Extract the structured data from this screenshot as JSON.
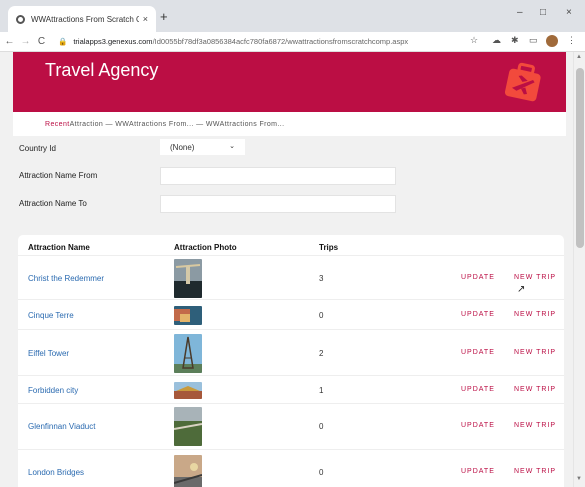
{
  "browser": {
    "tab_title": "WWAttractions From Scratch Co",
    "tab_close": "×",
    "new_tab": "+",
    "window_controls": {
      "minimize": "–",
      "maximize": "□",
      "close": "×"
    },
    "nav": {
      "back": "←",
      "forward": "→",
      "reload": "C"
    },
    "url_host": "trialapps3.genexus.com",
    "url_path": "/Id0055bf78df3a0856384acfc780fa6872/wwattractionsfromscratchcomp.aspx",
    "toolbar_icons": [
      "star-icon",
      "cloud-icon",
      "puzzle-icon",
      "cast-icon",
      "profile-avatar",
      "menu-icon"
    ]
  },
  "header": {
    "brand": "Travel Agency",
    "logo_icon": "suitcase-plane-icon",
    "accent_color": "#bb0e44"
  },
  "breadcrumb": {
    "recent": "Recent",
    "trail": "Attraction — WWAttractions From... — WWAttractions From..."
  },
  "filters": {
    "country_label": "Country Id",
    "country_value": "(None)",
    "name_from_label": "Attraction Name From",
    "name_to_label": "Attraction Name To"
  },
  "grid": {
    "columns": [
      "Attraction Name",
      "Attraction Photo",
      "Trips"
    ],
    "update_label": "UPDATE",
    "new_trip_label": "NEW TRIP",
    "rows": [
      {
        "name": "Christ the Redemmer",
        "trips": "3",
        "photo": "christ-photo"
      },
      {
        "name": "Cinque Terre",
        "trips": "0",
        "photo": "cinque-photo"
      },
      {
        "name": "Eiffel Tower",
        "trips": "2",
        "photo": "eiffel-photo"
      },
      {
        "name": "Forbidden city",
        "trips": "1",
        "photo": "forbidden-photo"
      },
      {
        "name": "Glenfinnan Viaduct",
        "trips": "0",
        "photo": "glenfinnan-photo"
      },
      {
        "name": "London Bridges",
        "trips": "0",
        "photo": "london-photo"
      }
    ]
  }
}
